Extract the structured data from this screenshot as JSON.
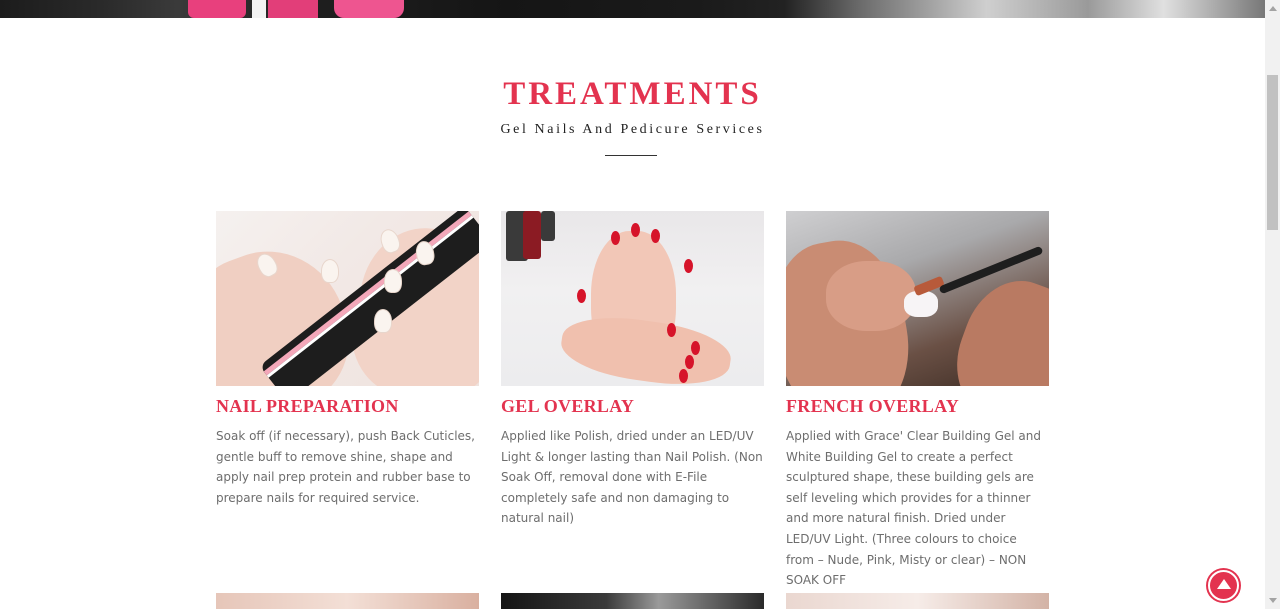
{
  "section": {
    "title": "TREATMENTS",
    "subtitle": "Gel Nails And Pedicure Services"
  },
  "treatments": [
    {
      "title": "NAIL PREPARATION",
      "description": "Soak off (if necessary), push Back Cuticles, gentle buff to remove shine, shape and apply nail prep protein and rubber base to prepare nails for required service."
    },
    {
      "title": "GEL OVERLAY",
      "description": "Applied like Polish, dried under an LED/UV Light & longer lasting than Nail Polish. (Non Soak Off, removal done with E-File completely safe and non damaging to natural nail)"
    },
    {
      "title": "FRENCH OVERLAY",
      "description": "Applied with Grace' Clear Building Gel and White Building Gel to create a perfect sculptured shape, these building gels are self leveling which provides for a thinner and more natural finish. Dried under LED/UV Light. (Three colours to choice from – Nude, Pink, Misty or clear) – NON SOAK OFF"
    }
  ],
  "colors": {
    "accent": "#e3334f",
    "text": "#6d6d6d",
    "heading_dark": "#222222"
  },
  "icons": {
    "back_to_top": "arrow-up-circle-icon"
  }
}
